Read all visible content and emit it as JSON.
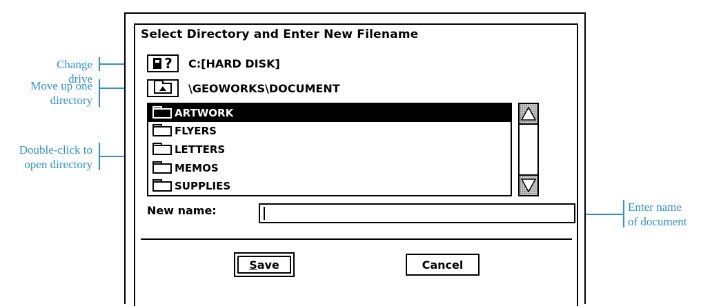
{
  "dialog": {
    "title": "Select Directory and Enter New Filename",
    "drive_icon_text": "?",
    "drive_label": "C:[HARD DISK]",
    "path_label": "\\GEOWORKS\\DOCUMENT",
    "directories": [
      {
        "name": "ARTWORK",
        "selected": true
      },
      {
        "name": "FLYERS",
        "selected": false
      },
      {
        "name": "LETTERS",
        "selected": false
      },
      {
        "name": "MEMOS",
        "selected": false
      },
      {
        "name": "SUPPLIES",
        "selected": false
      }
    ],
    "new_name_label": "New name:",
    "new_name_value": "",
    "save_mnemonic": "S",
    "save_rest": "ave",
    "cancel_label": "Cancel"
  },
  "annotations": {
    "change_drive": "Change drive",
    "move_up_line1": "Move up one",
    "move_up_line2": "directory",
    "double_click_line1": "Double-click to",
    "double_click_line2": "open directory",
    "enter_name_line1": "Enter name",
    "enter_name_line2": "of document"
  },
  "colors": {
    "annotation": "#2f8fd0",
    "selected_row_bg": "#000000",
    "selected_row_fg": "#ffffff"
  },
  "icons": {
    "drive": "disk-drive-icon",
    "up": "folder-up-icon",
    "folder": "folder-icon",
    "scroll_up": "scroll-up-arrow-icon",
    "scroll_down": "scroll-down-arrow-icon"
  }
}
